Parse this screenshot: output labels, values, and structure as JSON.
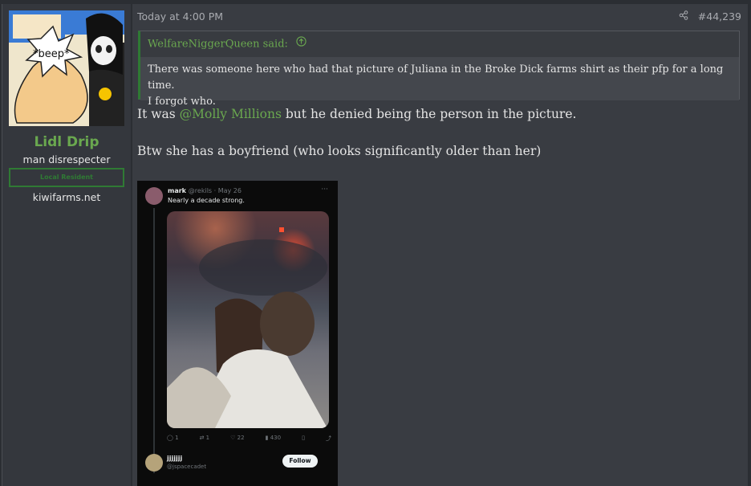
{
  "user": {
    "avatar_text": "*beep*",
    "avatar_logo": "Lidl",
    "name": "Lidl Drip",
    "title": "man disrespecter",
    "banner": "Local Resident",
    "site": "kiwifarms.net"
  },
  "post": {
    "date": "Today at 4:00 PM",
    "number": "#44,239",
    "share_icon": "share-icon"
  },
  "quote": {
    "author": "WelfareNiggerQueen said:",
    "icon": "arrow-up-circle-icon",
    "lines": [
      "There was someone here who had that picture of Juliana in the Broke Dick farms shirt as their pfp for a long time.",
      "I forgot who."
    ]
  },
  "message": {
    "line1_prefix": "It was ",
    "mention": "@Molly Millions",
    "line1_suffix": " but he denied being the person in the picture.",
    "line2": "Btw she has a boyfriend (who looks significantly older than her)"
  },
  "tweet": {
    "author": "mark",
    "handle": "@rekils · May 26",
    "text": "Nearly a decade strong.",
    "more": "···",
    "stats": {
      "replies": "1",
      "retweets": "1",
      "likes": "22",
      "views": "430"
    },
    "reply_name": "jjjjjjj",
    "reply_handle": "@jspacecadet",
    "follow_label": "Follow"
  },
  "colors": {
    "accent_green": "#6aa84f",
    "background": "#393c42"
  }
}
